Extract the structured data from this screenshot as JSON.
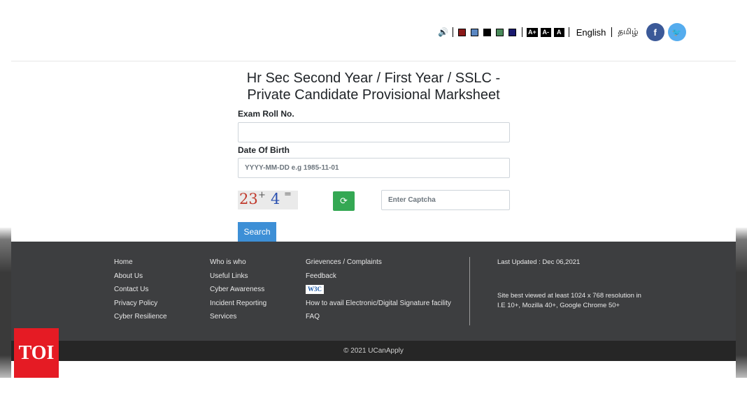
{
  "header": {
    "speaker_icon": "speaker-icon",
    "color_swatches": [
      "#8b1a1a",
      "#5b87c2",
      "#000000",
      "#4a8a5a",
      "#1a1a6e"
    ],
    "font_sizes": [
      "A+",
      "A-",
      "A"
    ],
    "lang_english": "English",
    "lang_tamil": "தமிழ்",
    "facebook_glyph": "f",
    "twitter_glyph": "🐦",
    "facebook_color": "#3b5998",
    "twitter_color": "#55acee"
  },
  "form": {
    "title_line1": "Hr Sec Second Year / First Year / SSLC -",
    "title_line2": "Private Candidate Provisional Marksheet",
    "roll_label": "Exam Roll No.",
    "roll_value": "",
    "dob_label": "Date Of Birth",
    "dob_placeholder": "YYYY-MM-DD e.g 1985-11-01",
    "captcha_a": "23",
    "captcha_op": "+",
    "captcha_b": "4",
    "captcha_eq": "=",
    "refresh_icon": "refresh-icon",
    "captcha_placeholder": "Enter Captcha",
    "search_label": "Search",
    "accent": "#3d8fd6"
  },
  "footer": {
    "col1": [
      "Home",
      "About Us",
      "Contact Us",
      "Privacy Policy",
      "Cyber Resilience"
    ],
    "col2": [
      "Who is who",
      "Useful Links",
      "Cyber Awareness",
      "Incident Reporting",
      "Services"
    ],
    "col3_a": [
      "Grievences / Complaints",
      "Feedback"
    ],
    "w3c_badge": "W3C",
    "col3_b": [
      "How to avail Electronic/Digital Signature facility",
      "FAQ"
    ],
    "last_updated": "Last Updated : Dec 06,2021",
    "best_viewed_line1": "Site best viewed at least 1024 x 768 resolution in",
    "best_viewed_line2": "I.E 10+, Mozilla 40+, Google Chrome 50+",
    "copyright": "© 2021 UCanApply",
    "bg": "#3d3e40"
  },
  "watermark": {
    "logo_text": "TOI"
  }
}
